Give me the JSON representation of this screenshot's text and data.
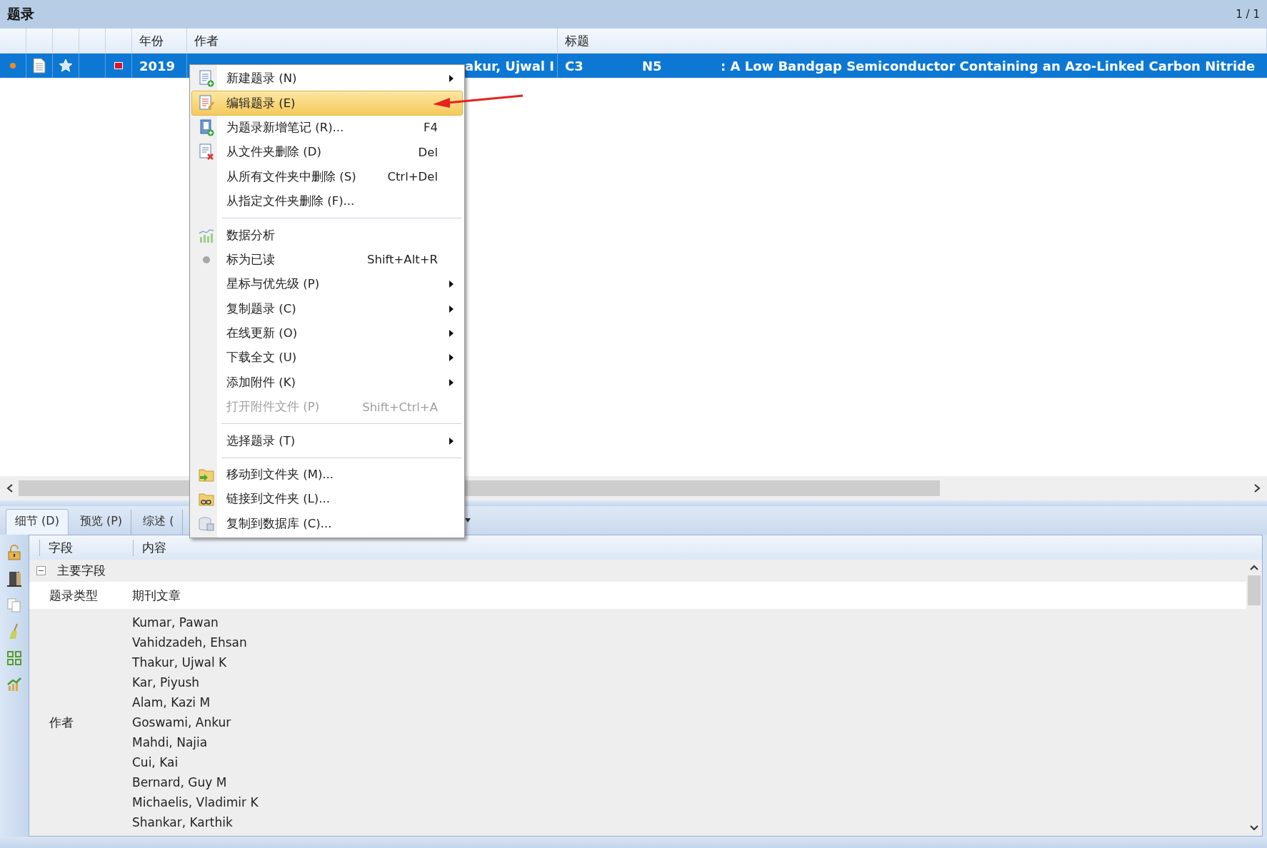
{
  "panel": {
    "title": "题录",
    "page": "1 / 1"
  },
  "table": {
    "columns": [
      "年份",
      "作者",
      "标题"
    ],
    "rows": [
      {
        "selected": true,
        "unread": true,
        "flagged": true,
        "year": "2019",
        "author": "akur, Ujwal I",
        "title_parts": [
          "C3",
          "N5",
          ": A Low Bandgap Semiconductor Containing an Azo-Linked Carbon Nitride"
        ]
      }
    ]
  },
  "detail_tabs": [
    {
      "label": "细节 (D)",
      "selected": true
    },
    {
      "label": "预览 (P)",
      "selected": false
    },
    {
      "label": "综述 (",
      "selected": false
    }
  ],
  "detail": {
    "columns": [
      "字段",
      "内容"
    ],
    "group": {
      "label": "主要字段",
      "expanded": true
    },
    "fields": [
      {
        "name": "题录类型",
        "values": [
          "期刊文章"
        ]
      },
      {
        "name": "作者",
        "values": [
          "Kumar, Pawan",
          "Vahidzadeh, Ehsan",
          "Thakur, Ujwal K",
          "Kar, Piyush",
          "Alam, Kazi M",
          "Goswami, Ankur",
          "Mahdi, Najia",
          "Cui, Kai",
          "Bernard, Guy M",
          "Michaelis, Vladimir K",
          "Shankar, Karthik"
        ]
      }
    ]
  },
  "context_menu": {
    "sections": [
      [
        {
          "label": "新建题录 (N)",
          "submenu": true,
          "selected": false,
          "disabled": false
        },
        {
          "label": "编辑题录 (E)",
          "submenu": false,
          "selected": true,
          "disabled": false
        },
        {
          "label": "为题录新增笔记 (R)...",
          "shortcut": "F4",
          "submenu": false,
          "selected": false,
          "disabled": false
        },
        {
          "label": "从文件夹删除 (D)",
          "shortcut": "Del",
          "submenu": false,
          "selected": false,
          "disabled": false
        },
        {
          "label": "从所有文件夹中删除 (S)",
          "shortcut": "Ctrl+Del",
          "submenu": false,
          "selected": false,
          "disabled": false
        },
        {
          "label": "从指定文件夹删除 (F)...",
          "submenu": false,
          "selected": false,
          "disabled": false
        }
      ],
      [
        {
          "label": "数据分析",
          "submenu": false,
          "selected": false,
          "disabled": false
        },
        {
          "label": "标为已读",
          "shortcut": "Shift+Alt+R",
          "submenu": false,
          "selected": false,
          "disabled": false
        },
        {
          "label": "星标与优先级 (P)",
          "submenu": true,
          "selected": false,
          "disabled": false
        },
        {
          "label": "复制题录 (C)",
          "submenu": true,
          "selected": false,
          "disabled": false
        },
        {
          "label": "在线更新 (O)",
          "submenu": true,
          "selected": false,
          "disabled": false
        },
        {
          "label": "下载全文 (U)",
          "submenu": true,
          "selected": false,
          "disabled": false
        },
        {
          "label": "添加附件 (K)",
          "submenu": true,
          "selected": false,
          "disabled": false
        },
        {
          "label": "打开附件文件 (P)",
          "shortcut": "Shift+Ctrl+A",
          "submenu": false,
          "selected": false,
          "disabled": true
        }
      ],
      [
        {
          "label": "选择题录 (T)",
          "submenu": true,
          "selected": false,
          "disabled": false
        }
      ],
      [
        {
          "label": "移动到文件夹 (M)...",
          "submenu": false,
          "selected": false,
          "disabled": false
        },
        {
          "label": "链接到文件夹 (L)...",
          "submenu": false,
          "selected": false,
          "disabled": false
        },
        {
          "label": "复制到数据库 (C)...",
          "submenu": false,
          "selected": false,
          "disabled": false
        }
      ]
    ]
  }
}
